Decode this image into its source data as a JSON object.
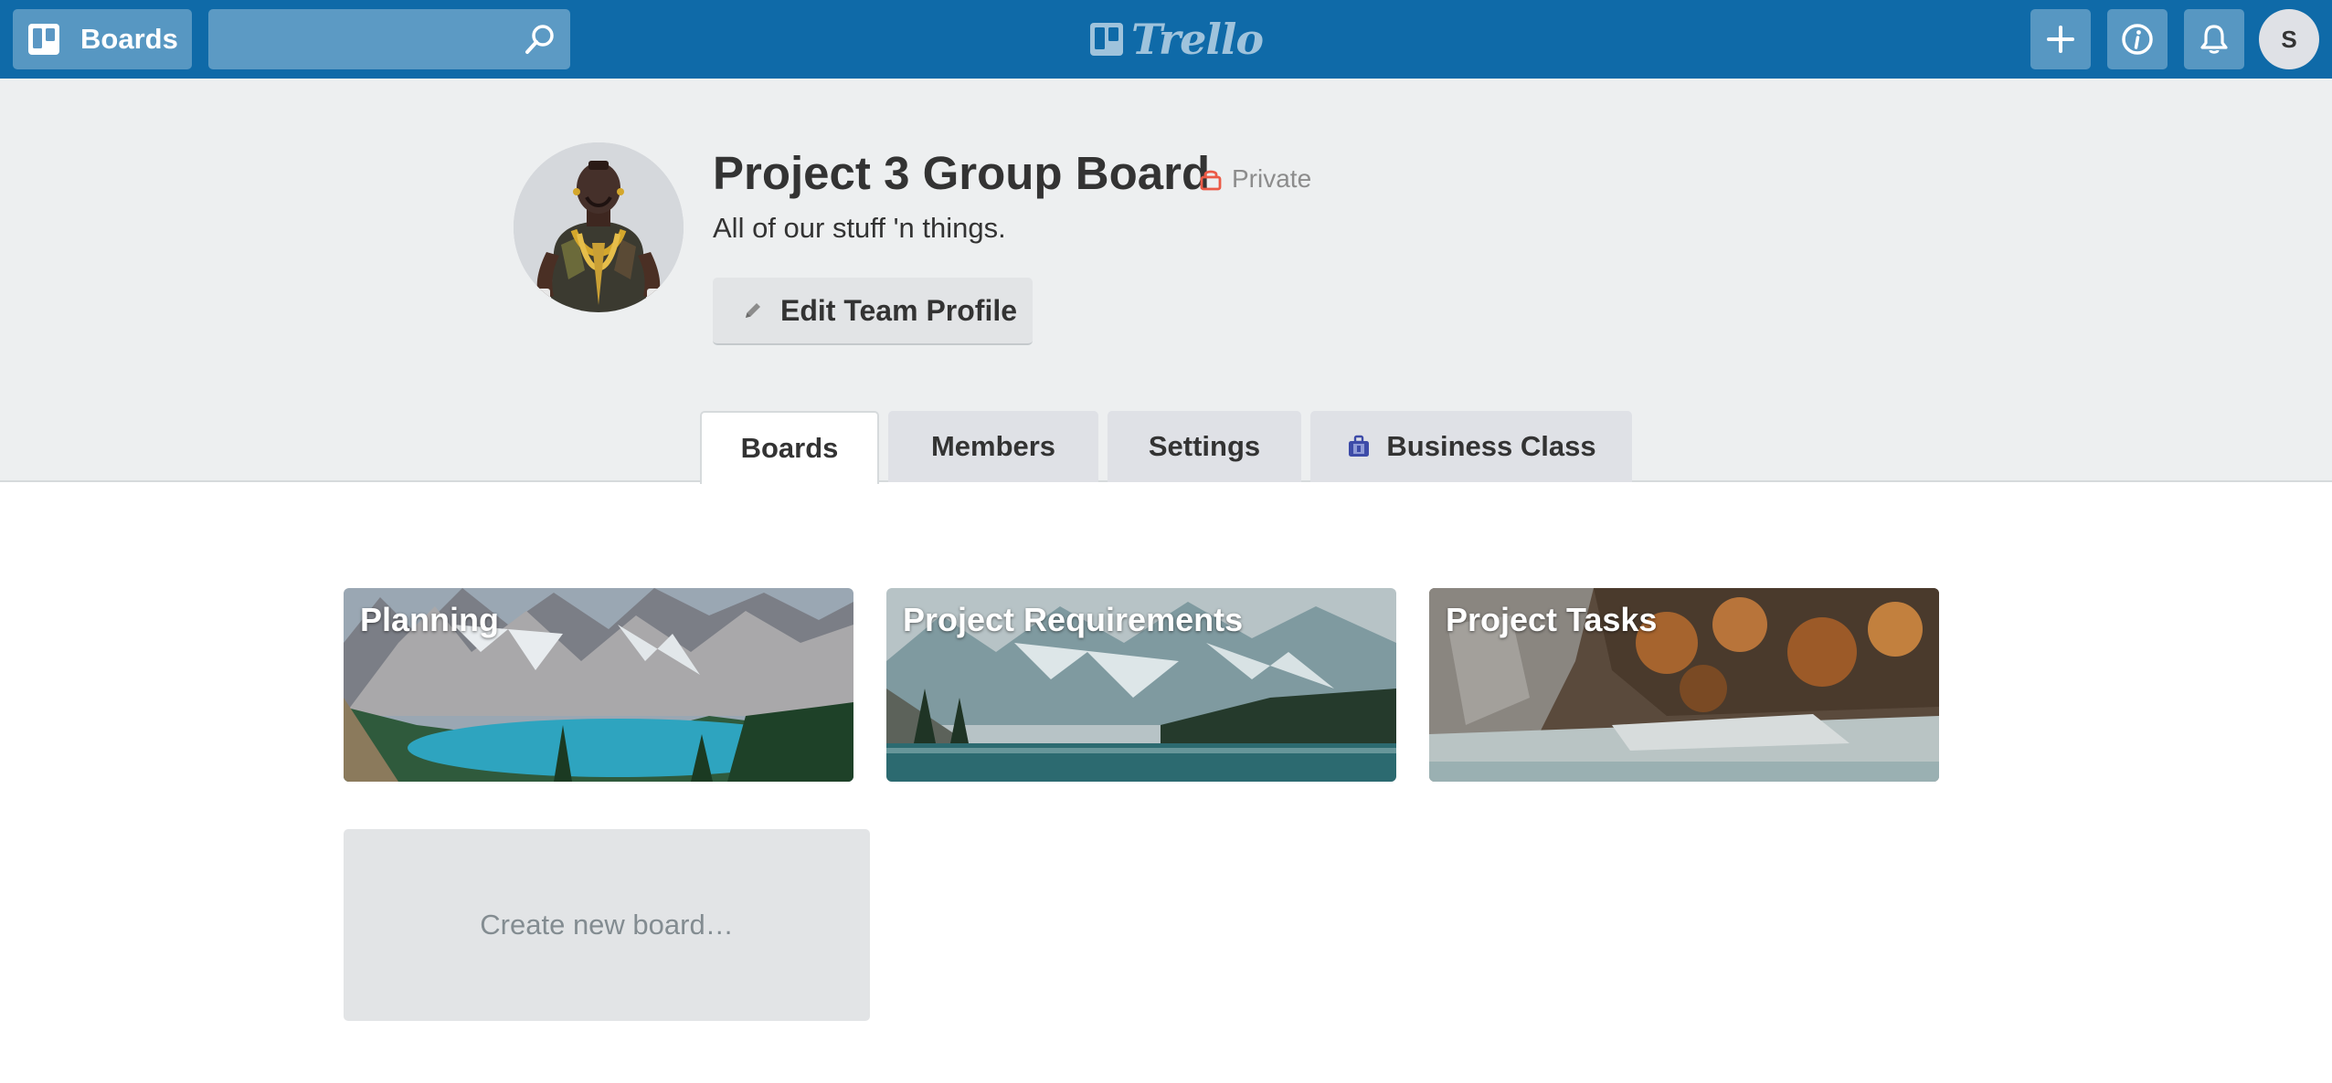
{
  "topbar": {
    "boards_button_label": "Boards",
    "search_value": "",
    "logo_text": "Trello",
    "avatar_initial": "S",
    "color": "#0f6aa8"
  },
  "team": {
    "name": "Project 3 Group Board",
    "privacy_label": "Private",
    "description": "All of our stuff 'n things.",
    "edit_button_label": "Edit Team Profile"
  },
  "tabs": [
    {
      "label": "Boards",
      "active": true
    },
    {
      "label": "Members",
      "active": false
    },
    {
      "label": "Settings",
      "active": false
    },
    {
      "label": "Business Class",
      "active": false,
      "icon": "briefcase-icon"
    }
  ],
  "boards": [
    {
      "title": "Planning"
    },
    {
      "title": "Project Requirements"
    },
    {
      "title": "Project Tasks"
    }
  ],
  "create_board_label": "Create new board…",
  "colors": {
    "header_bg": "#edeff0",
    "tab_bg": "#dfe1e6",
    "privacy_icon": "#eb5a46",
    "business_icon": "#3d4ba8"
  }
}
